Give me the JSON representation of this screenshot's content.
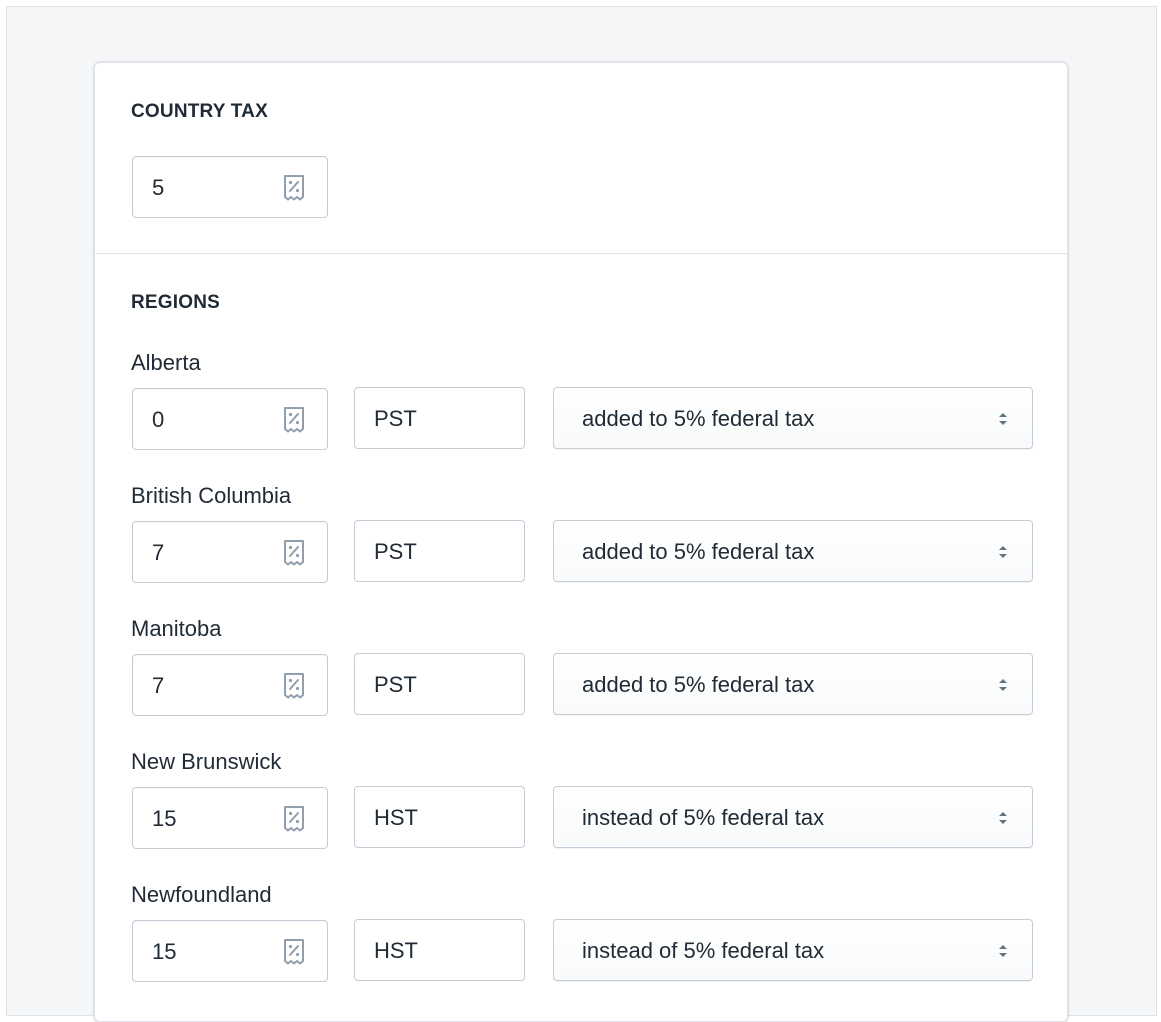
{
  "country_tax": {
    "heading": "COUNTRY TAX",
    "value": "5",
    "icon": "receipt-percent-icon"
  },
  "regions": {
    "heading": "REGIONS",
    "items": [
      {
        "name": "Alberta",
        "rate": "0",
        "tax_name": "PST",
        "mode": "added to 5% federal tax"
      },
      {
        "name": "British Columbia",
        "rate": "7",
        "tax_name": "PST",
        "mode": "added to 5% federal tax"
      },
      {
        "name": "Manitoba",
        "rate": "7",
        "tax_name": "PST",
        "mode": "added to 5% federal tax"
      },
      {
        "name": "New Brunswick",
        "rate": "15",
        "tax_name": "HST",
        "mode": "instead of 5% federal tax"
      },
      {
        "name": "Newfoundland",
        "rate": "15",
        "tax_name": "HST",
        "mode": "instead of 5% federal tax"
      }
    ]
  },
  "colors": {
    "background": "#f4f6f8",
    "card": "#ffffff",
    "border": "#c4cdd5",
    "text": "#212b36",
    "icon": "#919eab"
  }
}
